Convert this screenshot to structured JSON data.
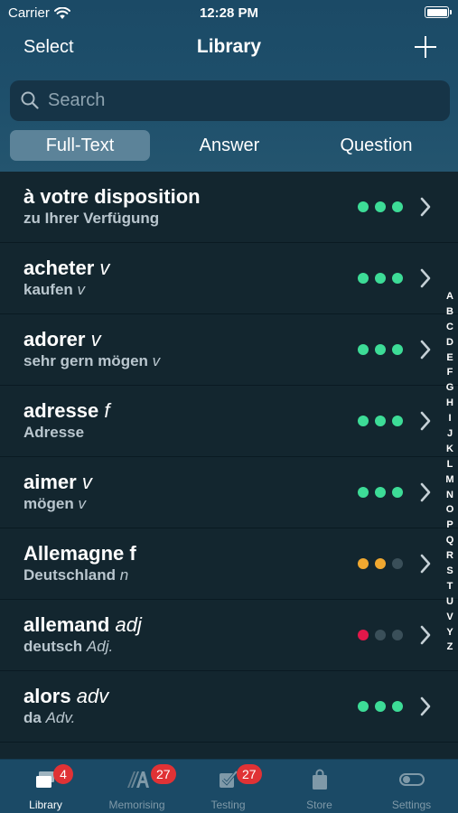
{
  "status_bar": {
    "carrier": "Carrier",
    "time": "12:28 PM"
  },
  "nav": {
    "select_label": "Select",
    "title": "Library",
    "add_icon": "plus-icon"
  },
  "search": {
    "placeholder": "Search",
    "value": ""
  },
  "segments": [
    {
      "label": "Full-Text",
      "selected": true
    },
    {
      "label": "Answer",
      "selected": false
    },
    {
      "label": "Question",
      "selected": false
    }
  ],
  "colors": {
    "dot_green": "#3ddc97",
    "dot_orange": "#f0a830",
    "dot_red": "#e2184a",
    "dot_gray": "#3a4f59"
  },
  "entries": [
    {
      "term": "à votre disposition",
      "term_pos": "",
      "translation": "zu Ihrer Verfügung",
      "translation_pos": "",
      "dots": [
        "green",
        "green",
        "green"
      ]
    },
    {
      "term": "acheter",
      "term_pos": "v",
      "translation": "kaufen",
      "translation_pos": "v",
      "dots": [
        "green",
        "green",
        "green"
      ]
    },
    {
      "term": "adorer",
      "term_pos": "v",
      "translation": "sehr gern mögen",
      "translation_pos": "v",
      "dots": [
        "green",
        "green",
        "green"
      ]
    },
    {
      "term": "adresse",
      "term_pos": "f",
      "translation": "Adresse",
      "translation_pos": "",
      "dots": [
        "green",
        "green",
        "green"
      ]
    },
    {
      "term": "aimer",
      "term_pos": "v",
      "translation": "mögen",
      "translation_pos": "v",
      "dots": [
        "green",
        "green",
        "green"
      ]
    },
    {
      "term": "Allemagne f",
      "term_pos": "",
      "translation": "Deutschland",
      "translation_pos": "n",
      "dots": [
        "orange",
        "orange",
        "gray"
      ]
    },
    {
      "term": "allemand",
      "term_pos": "adj",
      "translation": "deutsch",
      "translation_pos": "Adj.",
      "dots": [
        "red",
        "gray",
        "gray"
      ]
    },
    {
      "term": "alors",
      "term_pos": "adv",
      "translation": "da",
      "translation_pos": "Adv.",
      "dots": [
        "green",
        "green",
        "green"
      ]
    }
  ],
  "alphabet_index": [
    "A",
    "B",
    "C",
    "D",
    "E",
    "F",
    "G",
    "H",
    "I",
    "J",
    "K",
    "L",
    "M",
    "N",
    "O",
    "P",
    "Q",
    "R",
    "S",
    "T",
    "U",
    "V",
    "Y",
    "Z"
  ],
  "tabs": [
    {
      "label": "Library",
      "badge": "4",
      "icon": "library-cards-icon",
      "active": true
    },
    {
      "label": "Memorising",
      "badge": "27",
      "icon": "memorising-icon",
      "active": false
    },
    {
      "label": "Testing",
      "badge": "27",
      "icon": "testing-checkbox-icon",
      "active": false
    },
    {
      "label": "Store",
      "badge": "",
      "icon": "shopping-bag-icon",
      "active": false
    },
    {
      "label": "Settings",
      "badge": "",
      "icon": "toggle-settings-icon",
      "active": false
    }
  ]
}
